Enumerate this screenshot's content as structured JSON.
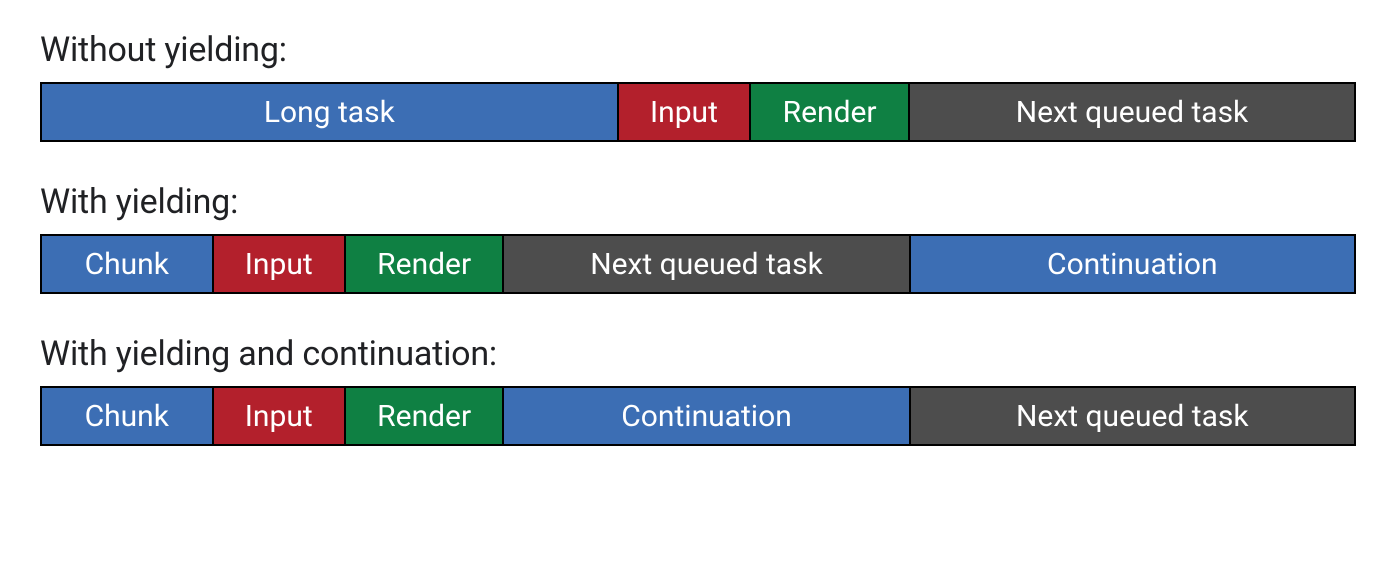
{
  "colors": {
    "blue": "#3c6eb4",
    "red": "#b3202c",
    "green": "#0f8043",
    "gray": "#4d4d4d"
  },
  "sections": {
    "noyield": {
      "title": "Without yielding:",
      "segments": [
        {
          "label": "Long task",
          "color": "blue",
          "flex": 44
        },
        {
          "label": "Input",
          "color": "red",
          "flex": 10
        },
        {
          "label": "Render",
          "color": "green",
          "flex": 12
        },
        {
          "label": "Next queued task",
          "color": "gray",
          "flex": 34
        }
      ]
    },
    "yielding": {
      "title": "With yielding:",
      "segments": [
        {
          "label": "Chunk",
          "color": "blue",
          "flex": 13
        },
        {
          "label": "Input",
          "color": "red",
          "flex": 10
        },
        {
          "label": "Render",
          "color": "green",
          "flex": 12
        },
        {
          "label": "Next queued task",
          "color": "gray",
          "flex": 31
        },
        {
          "label": "Continuation",
          "color": "blue",
          "flex": 34
        }
      ]
    },
    "continuation": {
      "title": "With yielding and continuation:",
      "segments": [
        {
          "label": "Chunk",
          "color": "blue",
          "flex": 13
        },
        {
          "label": "Input",
          "color": "red",
          "flex": 10
        },
        {
          "label": "Render",
          "color": "green",
          "flex": 12
        },
        {
          "label": "Continuation",
          "color": "blue",
          "flex": 31
        },
        {
          "label": "Next queued task",
          "color": "gray",
          "flex": 34
        }
      ]
    }
  }
}
